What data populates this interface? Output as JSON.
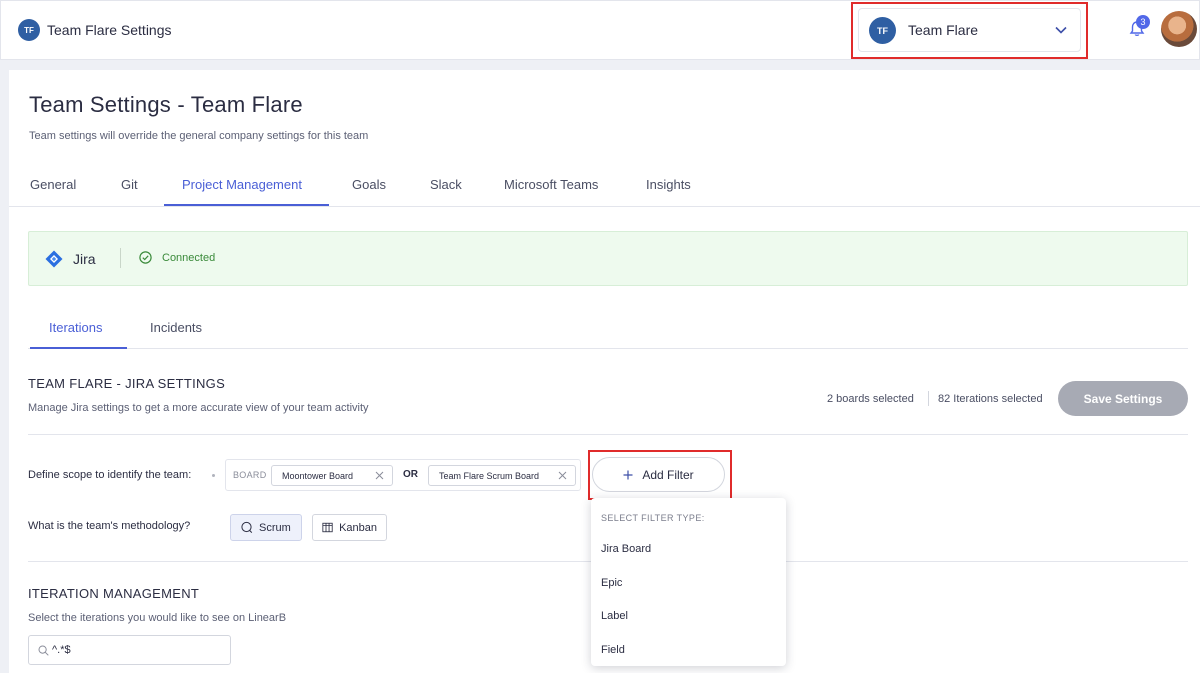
{
  "header": {
    "badge": "TF",
    "app_title": "Team Flare Settings",
    "team_selector": {
      "badge": "TF",
      "name": "Team Flare"
    },
    "notifications_count": "3"
  },
  "page": {
    "title": "Team Settings - Team Flare",
    "subtitle": "Team settings will override the general company settings for this team"
  },
  "tabs": [
    "General",
    "Git",
    "Project Management",
    "Goals",
    "Slack",
    "Microsoft Teams",
    "Insights"
  ],
  "active_tab": "Project Management",
  "integration": {
    "name": "Jira",
    "status": "Connected"
  },
  "subtabs": [
    "Iterations",
    "Incidents"
  ],
  "active_subtab": "Iterations",
  "jira_settings": {
    "title": "TEAM FLARE - JIRA SETTINGS",
    "subtitle": "Manage Jira settings to get a more accurate view of your team activity",
    "boards_selected": "2 boards selected",
    "iterations_selected": "82 Iterations selected",
    "save_label": "Save Settings"
  },
  "scope": {
    "label": "Define scope to identify the team:",
    "type_label": "BOARD",
    "chips": [
      "Moontower Board",
      "Team Flare Scrum Board"
    ],
    "operator": "OR",
    "add_filter_label": "Add Filter"
  },
  "methodology": {
    "label": "What is the team's methodology?",
    "options": [
      "Scrum",
      "Kanban"
    ],
    "selected": "Scrum"
  },
  "iteration_management": {
    "title": "ITERATION MANAGEMENT",
    "subtitle": "Select the iterations you would like to see on LinearB",
    "search_value": "^.*$"
  },
  "filter_dropdown": {
    "header": "SELECT FILTER TYPE:",
    "items": [
      "Jira Board",
      "Epic",
      "Label",
      "Field"
    ]
  },
  "colors": {
    "accent": "#4a5fd6",
    "highlight_outline": "#e02b2b",
    "connected_green": "#3a8a3a",
    "save_disabled": "#a7aab4"
  }
}
